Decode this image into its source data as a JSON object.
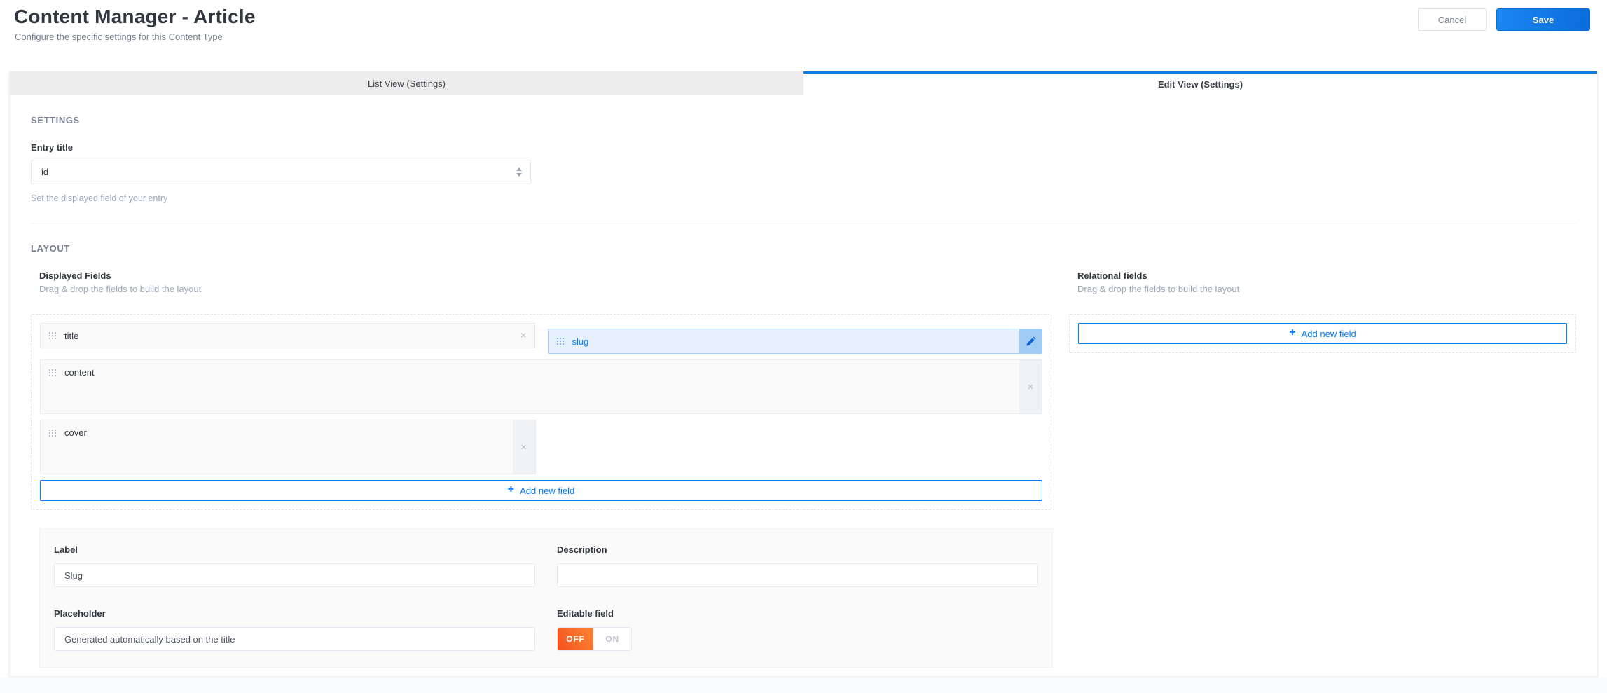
{
  "header": {
    "title": "Content Manager - Article",
    "subtitle": "Configure the specific settings for this Content Type",
    "cancel_label": "Cancel",
    "save_label": "Save"
  },
  "tabs": [
    {
      "label": "List View (Settings)",
      "active": false
    },
    {
      "label": "Edit View (Settings)",
      "active": true
    }
  ],
  "settings": {
    "section_title": "SETTINGS",
    "entry_title_label": "Entry title",
    "entry_title_value": "id",
    "entry_title_help": "Set the displayed field of your entry"
  },
  "layout": {
    "section_title": "LAYOUT",
    "displayed_fields": {
      "title": "Displayed Fields",
      "subtitle": "Drag & drop the fields to build the layout",
      "fields": [
        {
          "name": "title",
          "width": "half",
          "height": "normal",
          "selected": false
        },
        {
          "name": "slug",
          "width": "half",
          "height": "normal",
          "selected": true
        },
        {
          "name": "content",
          "width": "full",
          "height": "tall",
          "selected": false
        },
        {
          "name": "cover",
          "width": "half",
          "height": "tall",
          "selected": false
        }
      ],
      "add_button_label": "Add new field"
    },
    "relational_fields": {
      "title": "Relational fields",
      "subtitle": "Drag & drop the fields to build the layout",
      "add_button_label": "Add new field"
    }
  },
  "field_form": {
    "label": {
      "label": "Label",
      "value": "Slug"
    },
    "description": {
      "label": "Description",
      "value": ""
    },
    "placeholder": {
      "label": "Placeholder",
      "value": "Generated automatically based on the title"
    },
    "editable": {
      "label": "Editable field",
      "off_label": "OFF",
      "on_label": "ON",
      "value": "OFF"
    }
  },
  "icons": {
    "remove": "×",
    "add": "+"
  },
  "colors": {
    "accent": "#007eff",
    "selected_bg": "#e6f1fd",
    "selected_border": "#a5d0fa",
    "toggle_off": "#f4511e",
    "save_button": "#0d79e8"
  }
}
